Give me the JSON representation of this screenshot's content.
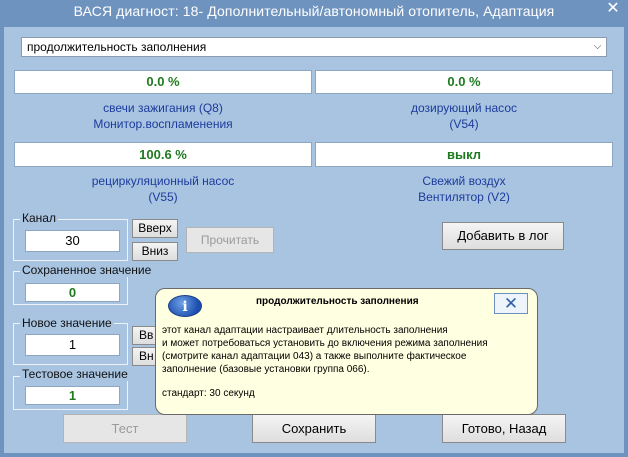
{
  "window": {
    "title": "ВАСЯ диагност: 18- Дополнительный/автономный отопитель, Адаптация",
    "close_glyph": "✕"
  },
  "channel_select": {
    "selected": "продолжительность заполнения"
  },
  "values": [
    {
      "value": "0.0 %",
      "label1": "свечи зажигания (Q8)",
      "label2": "Монитор.воспламенения"
    },
    {
      "value": "0.0 %",
      "label1": "дозирующий насос",
      "label2": "(V54)"
    },
    {
      "value": "100.6 %",
      "label1": "рециркуляционный насос",
      "label2": "(V55)"
    },
    {
      "value": "выкл",
      "label1": "Свежий воздух",
      "label2": "Вентилятор (V2)"
    }
  ],
  "channel": {
    "label": "Канал",
    "value": "30",
    "up": "Вверх",
    "down": "Вниз"
  },
  "read_button": "Прочитать",
  "add_log_button": "Добавить в лог",
  "saved": {
    "label": "Сохраненное значение",
    "value": "0"
  },
  "new_value": {
    "label": "Новое значение",
    "value": "1",
    "up_partial": "Вв",
    "down_partial": "Вн"
  },
  "test_value": {
    "label": "Тестовое значение",
    "value": "1"
  },
  "buttons": {
    "test": "Тест",
    "save": "Сохранить",
    "done": "Готово, Назад"
  },
  "tooltip": {
    "title": "продолжительность заполнения",
    "icon_letter": "i",
    "close_glyph": "✕",
    "lines": [
      "этот канал адаптации настраивает длительность заполнения",
      "и может потребоваться установить до включения режима заполнения",
      "(смотрите канал адаптации 043) а также выполните фактическое",
      "заполнение (базовые установки группа 066)."
    ],
    "default": "стандарт: 30 секунд"
  }
}
